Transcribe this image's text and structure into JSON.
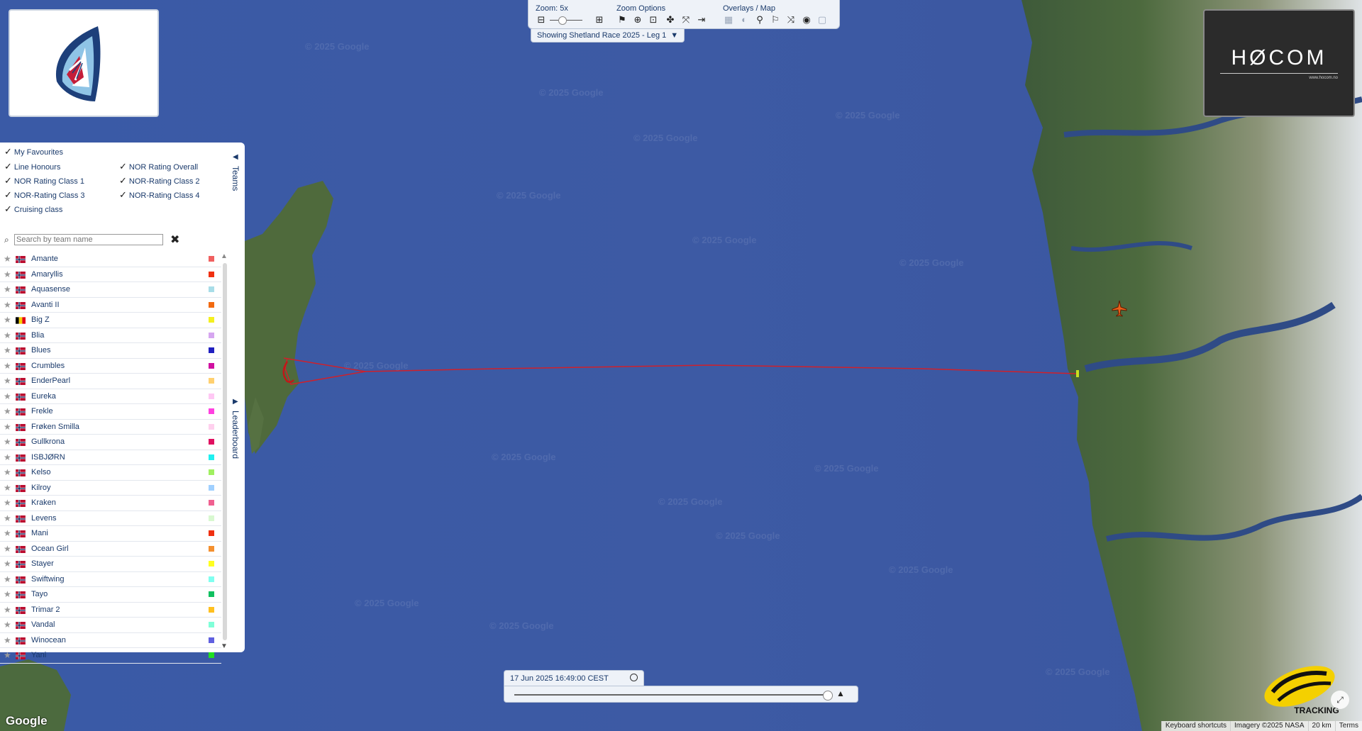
{
  "toolbar": {
    "zoom_label": "Zoom: 5x",
    "zoom_options_label": "Zoom Options",
    "overlays_label": "Overlays / Map",
    "race_select": "Showing Shetland Race 2025 - Leg 1"
  },
  "panel": {
    "favourites": "My Favourites",
    "filters": [
      "Line Honours",
      "NOR Rating Overall",
      "NOR Rating Class 1",
      "NOR-Rating Class 2",
      "NOR-Rating Class 3",
      "NOR-Rating Class 4",
      "Cruising class"
    ],
    "search_placeholder": "Search by team name",
    "teams_tab": "Teams",
    "leaderboard_tab": "Leaderboard",
    "teams": [
      {
        "name": "Amante",
        "flag": "NOR",
        "color": "#f06060"
      },
      {
        "name": "Amaryllis",
        "flag": "NOR",
        "color": "#f03010"
      },
      {
        "name": "Aquasense",
        "flag": "NOR",
        "color": "#a8dde8"
      },
      {
        "name": "Avanti II",
        "flag": "NOR",
        "color": "#f26a10"
      },
      {
        "name": "Big Z",
        "flag": "BEL",
        "color": "#f4f020"
      },
      {
        "name": "Blia",
        "flag": "NOR",
        "color": "#d6a6f0"
      },
      {
        "name": "Blues",
        "flag": "NOR",
        "color": "#2020c0"
      },
      {
        "name": "Crumbles",
        "flag": "NOR",
        "color": "#d010a0"
      },
      {
        "name": "EnderPearl",
        "flag": "NOR",
        "color": "#ffd070"
      },
      {
        "name": "Eureka",
        "flag": "NOR",
        "color": "#ffc8f4"
      },
      {
        "name": "Frekle",
        "flag": "NOR",
        "color": "#ff40e0"
      },
      {
        "name": "Frøken Smilla",
        "flag": "NOR",
        "color": "#ffd0ee"
      },
      {
        "name": "Gullkrona",
        "flag": "NOR",
        "color": "#e01060"
      },
      {
        "name": "ISBJØRN",
        "flag": "NOR",
        "color": "#20f0f0"
      },
      {
        "name": "Kelso",
        "flag": "NOR",
        "color": "#a0f060"
      },
      {
        "name": "Kilroy",
        "flag": "NOR",
        "color": "#a0d0ff"
      },
      {
        "name": "Kraken",
        "flag": "NOR",
        "color": "#f06090"
      },
      {
        "name": "Levens",
        "flag": "NOR",
        "color": "#d8f8d0"
      },
      {
        "name": "Mani",
        "flag": "NOR",
        "color": "#f03010"
      },
      {
        "name": "Ocean Girl",
        "flag": "NOR",
        "color": "#f49030"
      },
      {
        "name": "Stayer",
        "flag": "NOR",
        "color": "#ffff20"
      },
      {
        "name": "Swiftwing",
        "flag": "NOR",
        "color": "#80fff0"
      },
      {
        "name": "Tayo",
        "flag": "NOR",
        "color": "#10c060"
      },
      {
        "name": "Trimar 2",
        "flag": "NOR",
        "color": "#ffc020"
      },
      {
        "name": "Vandal",
        "flag": "NOR",
        "color": "#80ffd8"
      },
      {
        "name": "Winocean",
        "flag": "NOR",
        "color": "#6060e0"
      },
      {
        "name": "Yani",
        "flag": "NOR",
        "color": "#20e020"
      }
    ]
  },
  "time": {
    "current": "17 Jun 2025 16:49:00 CEST"
  },
  "brand": {
    "hocom_logo_text": "HØCOM",
    "hocom_url": "www.hocom.no",
    "yb_logo_text": "TRACKING"
  },
  "map": {
    "watermark": "© 2025 Google",
    "google_logo": "Google",
    "route_color": "#d0202a"
  },
  "attribution": {
    "shortcuts": "Keyboard shortcuts",
    "imagery": "Imagery ©2025 NASA",
    "scale": "20 km",
    "terms": "Terms"
  }
}
